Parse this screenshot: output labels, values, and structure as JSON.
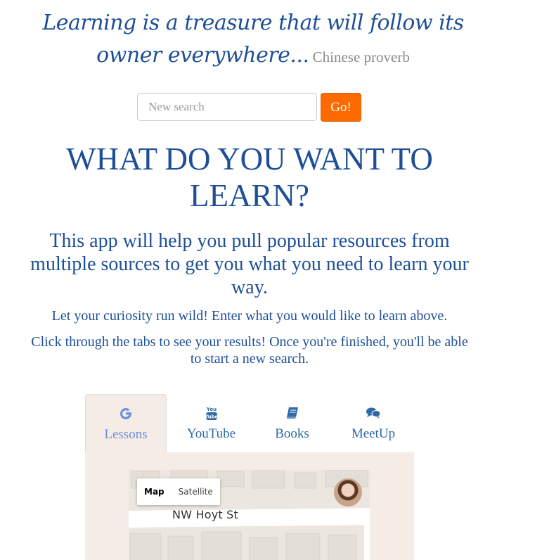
{
  "quote": {
    "text": "Learning is a treasure that will follow its owner everywhere...",
    "source": "Chinese proverb"
  },
  "search": {
    "placeholder": "New search",
    "value": "",
    "button_label": "Go!"
  },
  "headline": "WHAT DO YOU WANT TO LEARN?",
  "lead": "This app will help you pull popular resources from multiple sources to get you what you need to learn your way.",
  "para1": "Let your curiosity run wild! Enter what you would like to learn above.",
  "para2": "Click through the tabs to see your results! Once you're finished, you'll be able to start a new search.",
  "tabs": [
    {
      "label": "Lessons",
      "icon": "google-icon",
      "active": true
    },
    {
      "label": "YouTube",
      "icon": "youtube-icon",
      "active": false
    },
    {
      "label": "Books",
      "icon": "book-icon",
      "active": false
    },
    {
      "label": "MeetUp",
      "icon": "chat-icon",
      "active": false
    }
  ],
  "map": {
    "mode_map": "Map",
    "mode_satellite": "Satellite",
    "street_label": "NW Hoyt St"
  },
  "colors": {
    "heading": "#1e4f96",
    "accent": "#ff6a00",
    "panel": "#f4ece5"
  }
}
